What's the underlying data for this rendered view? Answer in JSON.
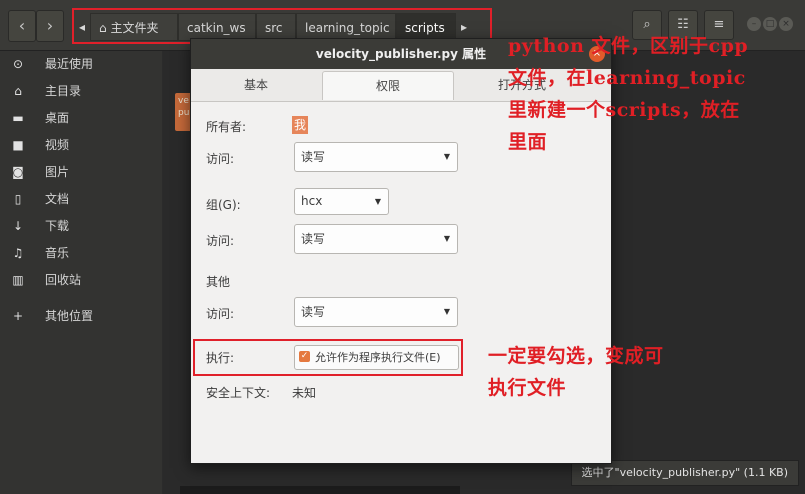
{
  "header": {
    "back_icon": "‹",
    "forward_icon": "›",
    "crumb_scroll_left": "◂",
    "crumb_scroll_right": "▸",
    "breadcrumbs": [
      "主文件夹",
      "catkin_ws",
      "src",
      "learning_topic",
      "scripts"
    ],
    "active_crumb": "scripts"
  },
  "sidebar": {
    "items": [
      {
        "icon": "clock-icon",
        "glyph": "⊙",
        "label": "最近使用"
      },
      {
        "icon": "home-icon",
        "glyph": "⌂",
        "label": "主目录"
      },
      {
        "icon": "folder-icon",
        "glyph": "▬",
        "label": "桌面"
      },
      {
        "icon": "video-icon",
        "glyph": "■",
        "label": "视频"
      },
      {
        "icon": "camera-icon",
        "glyph": "◙",
        "label": "图片"
      },
      {
        "icon": "document-icon",
        "glyph": "▯",
        "label": "文档"
      },
      {
        "icon": "download-icon",
        "glyph": "↓",
        "label": "下载"
      },
      {
        "icon": "music-icon",
        "glyph": "♫",
        "label": "音乐"
      },
      {
        "icon": "trash-icon",
        "glyph": "▥",
        "label": "回收站"
      },
      {
        "icon": "plus-icon",
        "glyph": "+",
        "label": "其他位置"
      }
    ]
  },
  "filearea": {
    "file_icon_text": "ve\npu",
    "status": "选中了\"velocity_publisher.py\" (1.1 KB)"
  },
  "dialog": {
    "title": "velocity_publisher.py 属性",
    "tabs": [
      "基本",
      "权限",
      "打开方式"
    ],
    "active_tab": "权限",
    "owner_label": "所有者:",
    "owner_value": "我",
    "owner_access_label": "访问:",
    "owner_access_value": "读写",
    "group_label": "组(G):",
    "group_value": "hcx",
    "group_access_label": "访问:",
    "group_access_value": "读写",
    "others_label": "其他",
    "others_access_label": "访问:",
    "others_access_value": "读写",
    "exec_label": "执行:",
    "exec_checkbox": "允许作为程序执行文件(E)",
    "exec_checked": true,
    "context_label": "安全上下文:",
    "context_value": "未知"
  },
  "annotations": {
    "top_note": "python 文件，区别于cpp文件，在learning_topic里新建一个scripts，放在里面",
    "top_note_lines": [
      "python 文件，区别于cpp",
      "文件，在learning_topic",
      "里新建一个scripts，放在",
      "里面"
    ],
    "exec_note_lines": [
      "一定要勾选，变成可",
      "执行文件"
    ]
  },
  "colors": {
    "annotation_red": "#e01f25",
    "accent_orange": "#e5793f"
  }
}
